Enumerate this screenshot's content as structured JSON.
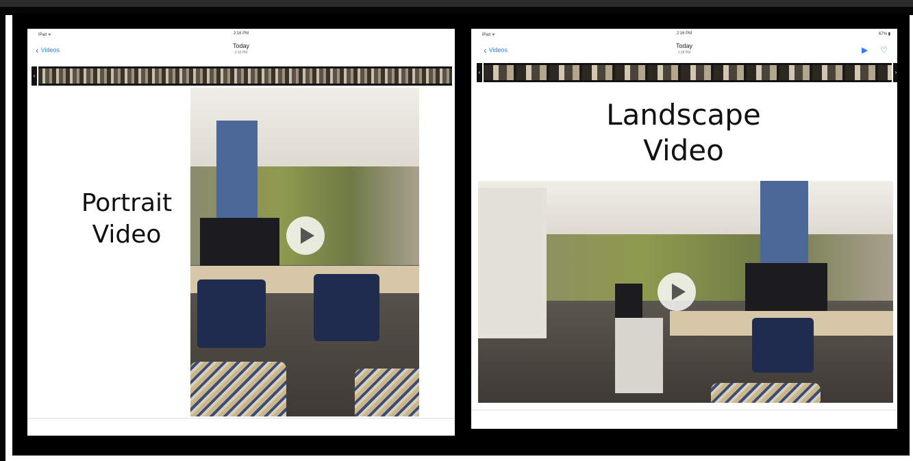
{
  "left_panel": {
    "status": {
      "device": "iPad ᯤ",
      "time": "2:16 PM"
    },
    "nav": {
      "back_label": "Videos",
      "title": "Today",
      "subtitle": "2:16 PM"
    },
    "caption_line1": "Portrait",
    "caption_line2": "Video",
    "play_icon": "play-circle-icon"
  },
  "right_panel": {
    "status": {
      "device": "iPad ᯤ",
      "time": "2:16 PM",
      "battery": "67% ▮"
    },
    "nav": {
      "back_label": "Videos",
      "title": "Today",
      "subtitle": "1:28 PM"
    },
    "caption_line1": "Landscape",
    "caption_line2": "Video",
    "play_icon": "play-circle-icon"
  },
  "colors": {
    "accent": "#2b7cf6",
    "frame": "#000000",
    "screen_bg": "#ffffff"
  }
}
